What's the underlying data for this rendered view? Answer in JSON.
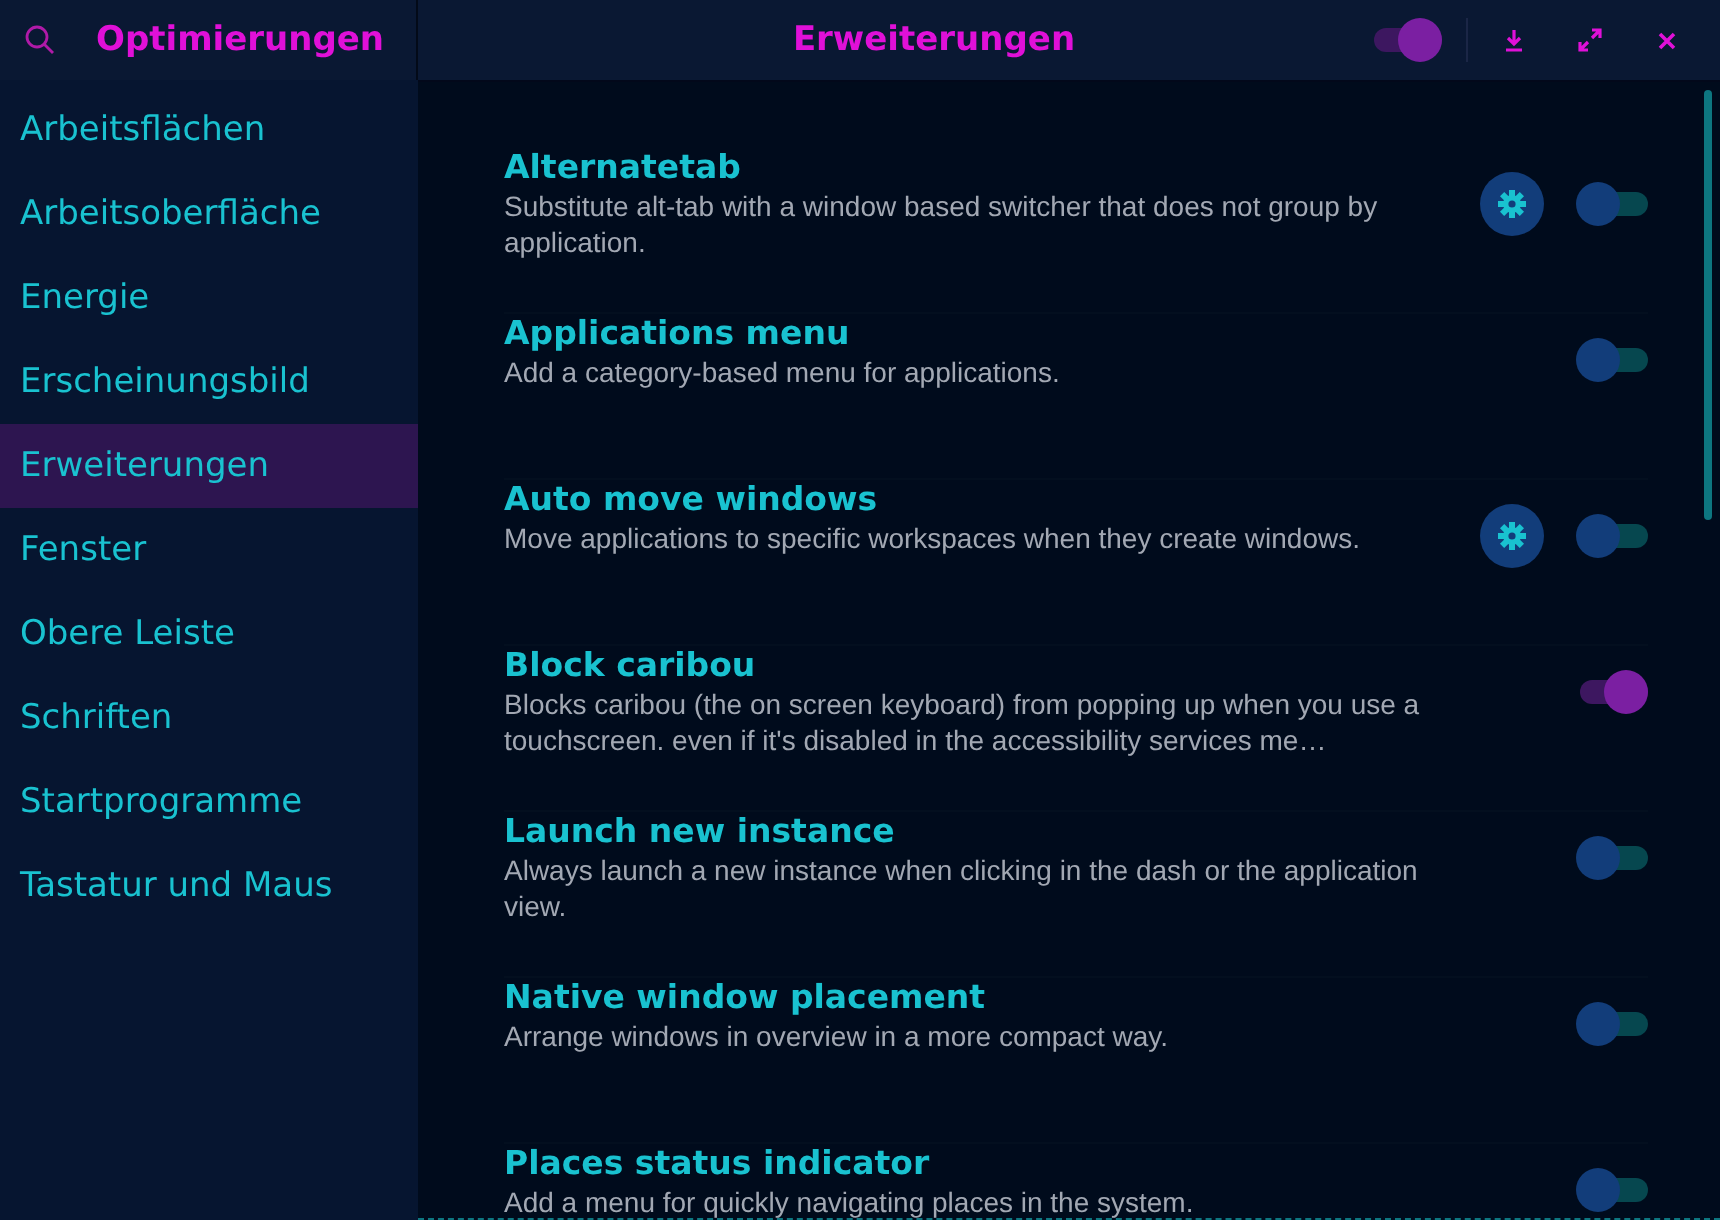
{
  "sidebar": {
    "title": "Optimierungen",
    "items": [
      {
        "label": "Arbeitsflächen",
        "selected": false
      },
      {
        "label": "Arbeitsoberfläche",
        "selected": false
      },
      {
        "label": "Energie",
        "selected": false
      },
      {
        "label": "Erscheinungsbild",
        "selected": false
      },
      {
        "label": "Erweiterungen",
        "selected": true
      },
      {
        "label": "Fenster",
        "selected": false
      },
      {
        "label": "Obere Leiste",
        "selected": false
      },
      {
        "label": "Schriften",
        "selected": false
      },
      {
        "label": "Startprogramme",
        "selected": false
      },
      {
        "label": "Tastatur und Maus",
        "selected": false
      }
    ]
  },
  "header": {
    "title": "Erweiterungen",
    "extensions_on": true
  },
  "extensions": [
    {
      "name": "Alternatetab",
      "description": "Substitute alt-tab with a window based switcher that does not group by application.",
      "has_settings": true,
      "on": false
    },
    {
      "name": "Applications menu",
      "description": "Add a category-based menu for applications.",
      "has_settings": false,
      "on": false
    },
    {
      "name": "Auto move windows",
      "description": "Move applications to specific workspaces when they create windows.",
      "has_settings": true,
      "on": false
    },
    {
      "name": "Block caribou",
      "description": "Blocks caribou (the on screen keyboard) from popping up when you use a touchscreen. even if it's disabled in the accessibility services me…",
      "has_settings": false,
      "on": true
    },
    {
      "name": "Launch new instance",
      "description": "Always launch a new instance when clicking in the dash or the application view.",
      "has_settings": false,
      "on": false
    },
    {
      "name": "Native window placement",
      "description": "Arrange windows in overview in a more compact way.",
      "has_settings": false,
      "on": false
    },
    {
      "name": "Places status indicator",
      "description": "Add a menu for quickly navigating places in the system.",
      "has_settings": false,
      "on": false
    }
  ]
}
